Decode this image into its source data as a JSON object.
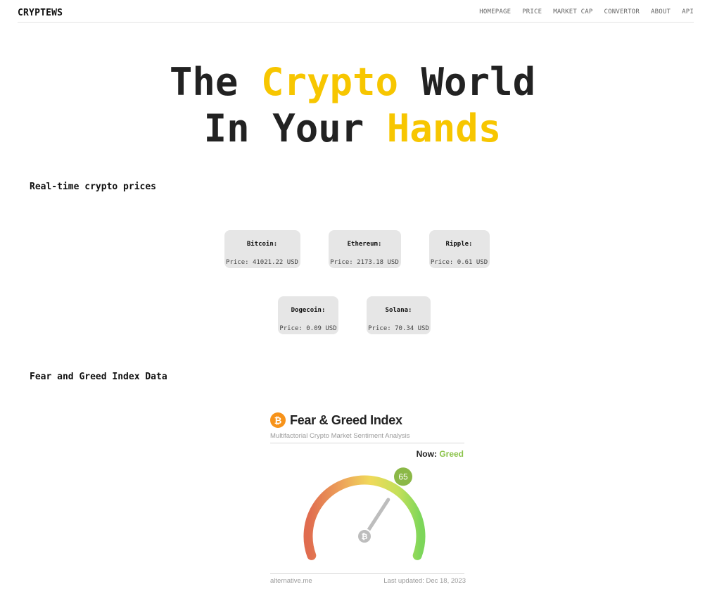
{
  "header": {
    "brand": "CRYPTEWS",
    "nav": [
      "HOMEPAGE",
      "PRICE",
      "MARKET CAP",
      "CONVERTOR",
      "ABOUT",
      "API"
    ]
  },
  "hero": {
    "line1_a": "The ",
    "line1_b": "Crypto",
    "line1_c": " World",
    "line2_a": "In Your ",
    "line2_b": "Hands"
  },
  "prices": {
    "title": "Real-time crypto prices",
    "price_prefix": "Price: ",
    "items": [
      {
        "name": "Bitcoin:",
        "price": "41021.22 USD"
      },
      {
        "name": "Ethereum:",
        "price": "2173.18 USD"
      },
      {
        "name": "Ripple:",
        "price": "0.61 USD"
      },
      {
        "name": "Dogecoin:",
        "price": "0.09 USD"
      },
      {
        "name": "Solana:",
        "price": "70.34 USD"
      }
    ]
  },
  "fear_greed": {
    "section_title": "Fear and Greed Index Data",
    "widget_title": "Fear & Greed Index",
    "subtitle": "Multifactorial Crypto Market Sentiment Analysis",
    "now_label": "Now:",
    "now_value": "Greed",
    "value": 65,
    "value_text": "65",
    "footer_left": "alternative.me",
    "footer_right": "Last updated: Dec 18, 2023",
    "colors": {
      "fear": "#e06c4f",
      "neutral": "#f0d95a",
      "greed": "#8bd65a",
      "badge": "#8bb847",
      "btc": "#f7931a",
      "accent": "#f7c600"
    }
  }
}
